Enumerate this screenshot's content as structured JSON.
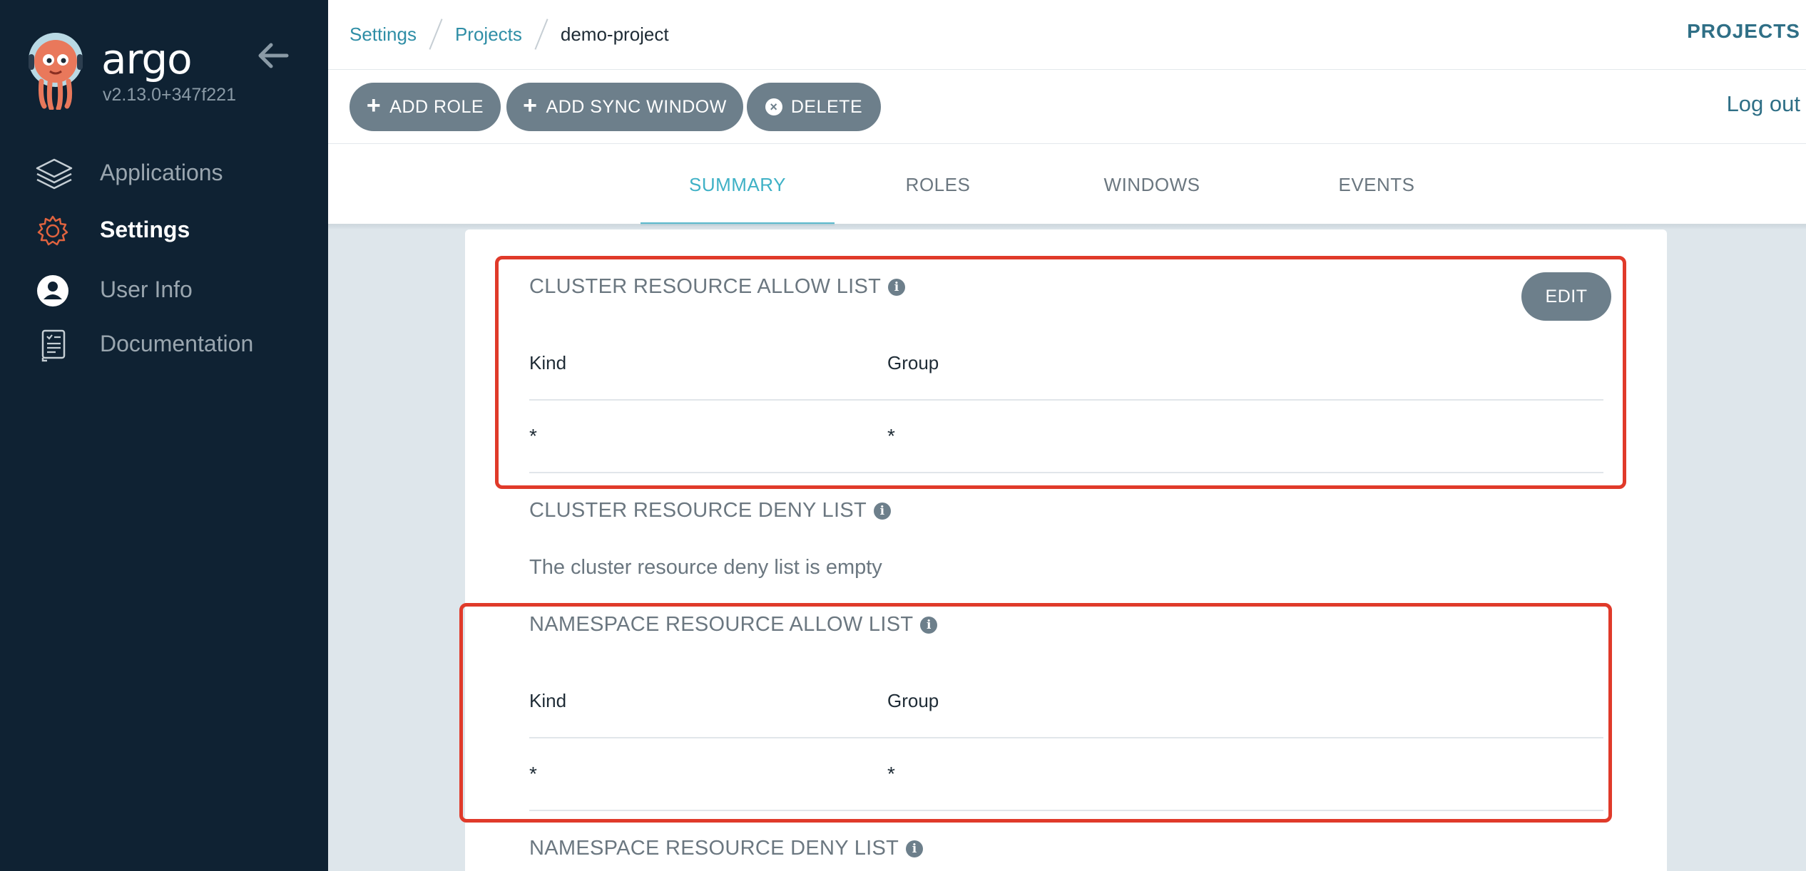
{
  "sidebar": {
    "logo_text": "argo",
    "version": "v2.13.0+347f221",
    "items": [
      {
        "label": "Applications",
        "icon": "layers-icon",
        "active": false
      },
      {
        "label": "Settings",
        "icon": "gear-icon",
        "active": true
      },
      {
        "label": "User Info",
        "icon": "user-circle-icon",
        "active": false
      },
      {
        "label": "Documentation",
        "icon": "book-icon",
        "active": false
      }
    ]
  },
  "header": {
    "breadcrumbs": [
      "Settings",
      "Projects",
      "demo-project"
    ],
    "right_label": "PROJECTS"
  },
  "toolbar": {
    "add_role": "ADD ROLE",
    "add_sync_window": "ADD SYNC WINDOW",
    "delete": "DELETE",
    "logout": "Log out"
  },
  "tabs": [
    {
      "label": "SUMMARY",
      "active": true
    },
    {
      "label": "ROLES",
      "active": false
    },
    {
      "label": "WINDOWS",
      "active": false
    },
    {
      "label": "EVENTS",
      "active": false
    }
  ],
  "content": {
    "edit_label": "EDIT",
    "cluster_allow": {
      "title": "CLUSTER RESOURCE ALLOW LIST",
      "columns": [
        "Kind",
        "Group"
      ],
      "rows": [
        [
          "*",
          "*"
        ]
      ]
    },
    "cluster_deny": {
      "title": "CLUSTER RESOURCE DENY LIST",
      "empty": "The cluster resource deny list is empty"
    },
    "namespace_allow": {
      "title": "NAMESPACE RESOURCE ALLOW LIST",
      "columns": [
        "Kind",
        "Group"
      ],
      "rows": [
        [
          "*",
          "*"
        ]
      ]
    },
    "namespace_deny": {
      "title": "NAMESPACE RESOURCE DENY LIST"
    }
  },
  "colors": {
    "sidebar_bg": "#0f2233",
    "accent": "#3fb1c6",
    "button_gray": "#6d7f8b",
    "highlight_red": "#e03a2a",
    "settings_icon": "#e0633f"
  }
}
